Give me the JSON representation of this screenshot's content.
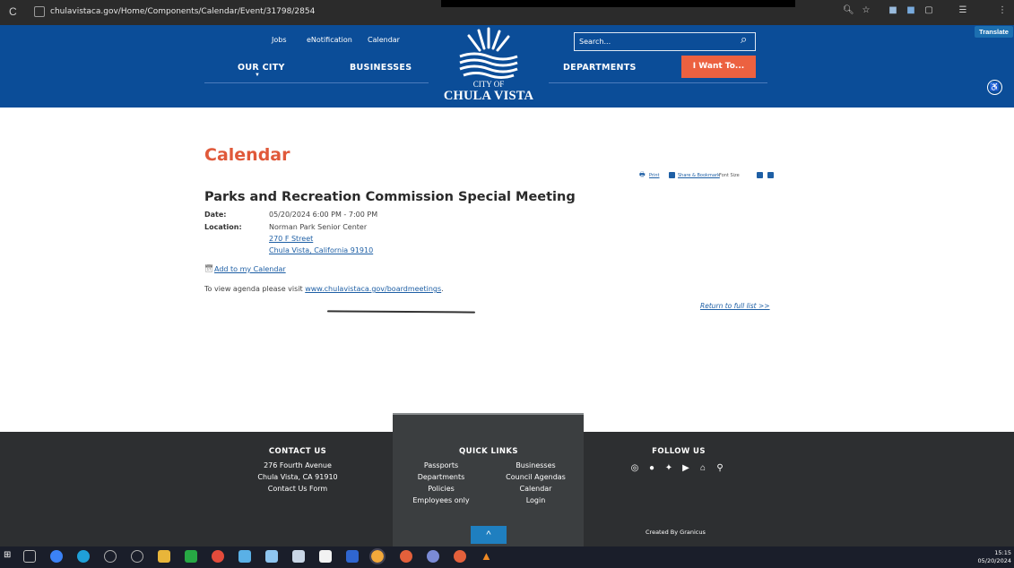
{
  "browser": {
    "url": "chulavistaca.gov/Home/Components/Calendar/Event/31798/2854",
    "reload_glyph": "C",
    "icons": [
      "zoom-icon",
      "star-icon",
      "extension-icon",
      "extension-icon",
      "sidepanel-icon",
      "profile-icon",
      "menu-icon"
    ]
  },
  "header": {
    "top_links": [
      "Jobs",
      "eNotification",
      "Calendar"
    ],
    "main_nav": {
      "our_city": "OUR CITY",
      "businesses": "BUSINESSES",
      "departments": "DEPARTMENTS"
    },
    "our_city_caret": "▼",
    "search_placeholder": "Search...",
    "search_icon": "⌕",
    "i_want_label": "I Want To...",
    "logo_line1": "CITY OF",
    "logo_line2": "CHULA VISTA",
    "translate_label": "Translate",
    "accessibility_glyph": "♿",
    "colors": {
      "header_bg": "#0b4d98",
      "accent": "#ec6140"
    }
  },
  "content": {
    "page_title": "Calendar",
    "tools": {
      "print": "Print",
      "share": "Share & Bookmark",
      "font_size": "Font Size"
    },
    "event_title": "Parks and Recreation Commission Special Meeting",
    "date_label": "Date:",
    "date_value": "05/20/2024 6:00 PM - 7:00 PM",
    "location_label": "Location:",
    "location_name": "Norman Park Senior Center",
    "location_street": "270 F Street",
    "location_city": "Chula Vista, California 91910",
    "add_calendar": "Add to my Calendar",
    "agenda_prefix": "To view agenda please visit ",
    "agenda_link": "www.chulavistaca.gov/boardmeetings",
    "agenda_suffix": ".",
    "return_link": "Return to full list >>"
  },
  "footer": {
    "contact_heading": "CONTACT US",
    "contact_address1": "276 Fourth Avenue",
    "contact_address2": "Chula Vista, CA 91910",
    "contact_form": "Contact Us Form",
    "quick_heading": "QUICK LINKS",
    "quick_left": [
      "Passports",
      "Departments",
      "Policies",
      "Employees only"
    ],
    "quick_right": [
      "Businesses",
      "Council Agendas",
      "Calendar",
      "Login"
    ],
    "follow_heading": "FOLLOW US",
    "social_icons": [
      "instagram-icon",
      "facebook-icon",
      "twitter-icon",
      "youtube-icon",
      "nextdoor-icon",
      "location-icon"
    ],
    "created_by": "Created By Granicus",
    "up_glyph": "^"
  },
  "taskbar": {
    "time": "15:15",
    "date": "05/20/2024",
    "colors": {
      "bg": "#1a1e2a"
    }
  }
}
